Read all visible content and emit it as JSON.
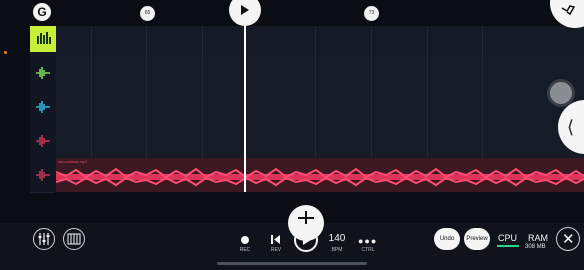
{
  "ruler": {
    "logo_glyph": "G",
    "markers": [
      {
        "label": "65"
      },
      {
        "label": "73"
      }
    ]
  },
  "tracks": [
    {
      "name": "mixer",
      "icon": "mixer-bars-icon",
      "color": "#c7ef3a"
    },
    {
      "name": "track-green",
      "icon": "waveform-icon",
      "color": "#7ed957"
    },
    {
      "name": "track-cyan",
      "icon": "waveform-icon",
      "color": "#2fb3d9"
    },
    {
      "name": "track-red",
      "icon": "waveform-icon",
      "color": "#d63b5c"
    },
    {
      "name": "track-audio",
      "icon": "waveform-icon",
      "color": "#d63b5c"
    }
  ],
  "audio_clip": {
    "name": "smoochbak.mp3",
    "color": "#e0335a"
  },
  "transport": {
    "rec_label": "REC",
    "rev_label": "REV",
    "bpm_value": "140",
    "bpm_label": "BPM",
    "ctrl_label": "CTRL"
  },
  "buttons": {
    "undo": "Undo",
    "preview": "Preview"
  },
  "stats": {
    "cpu_label": "CPU",
    "ram_label": "RAM",
    "ram_value": "308 MB",
    "cpu_color": "#27d48a"
  }
}
